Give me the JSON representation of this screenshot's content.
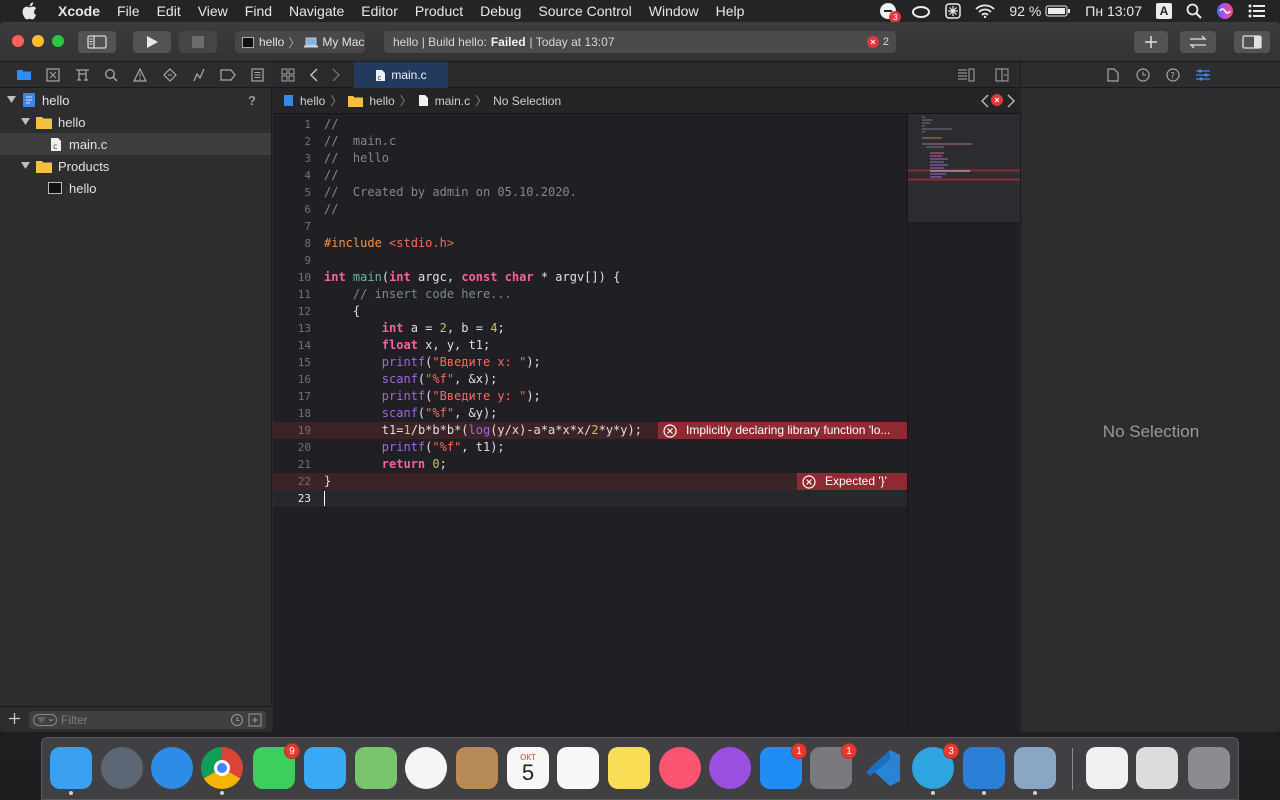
{
  "menubar": {
    "app": "Xcode",
    "items": [
      "File",
      "Edit",
      "View",
      "Find",
      "Navigate",
      "Editor",
      "Product",
      "Debug",
      "Source Control",
      "Window",
      "Help"
    ],
    "battery": "92 %",
    "clock": "Пн 13:07",
    "input": "A",
    "badge_count": "3"
  },
  "toolbar": {
    "scheme": "hello",
    "destination": "My Mac",
    "status_prefix": "hello | Build hello:",
    "status_result": "Failed",
    "status_suffix": "| Today at 13:07",
    "error_count": "2"
  },
  "navigator": {
    "tree": [
      {
        "label": "hello",
        "level": 0,
        "kind": "project",
        "badge": "?"
      },
      {
        "label": "hello",
        "level": 1,
        "kind": "folder"
      },
      {
        "label": "main.c",
        "level": 2,
        "kind": "cfile",
        "selected": true
      },
      {
        "label": "Products",
        "level": 1,
        "kind": "folder"
      },
      {
        "label": "hello",
        "level": 2,
        "kind": "exec"
      }
    ],
    "filter_placeholder": "Filter"
  },
  "editor": {
    "tab": "main.c",
    "jumpbar": [
      "hello",
      "hello",
      "main.c",
      "No Selection"
    ],
    "lines": [
      {
        "n": "1",
        "html": "<span class=\"cmt\">//</span>"
      },
      {
        "n": "2",
        "html": "<span class=\"cmt\">//  main.c</span>"
      },
      {
        "n": "3",
        "html": "<span class=\"cmt\">//  hello</span>"
      },
      {
        "n": "4",
        "html": "<span class=\"cmt\">//</span>"
      },
      {
        "n": "5",
        "html": "<span class=\"cmt\">//  Created by admin on 05.10.2020.</span>"
      },
      {
        "n": "6",
        "html": "<span class=\"cmt\">//</span>"
      },
      {
        "n": "7",
        "html": ""
      },
      {
        "n": "8",
        "html": "<span class=\"pp\">#include</span> <span class=\"inc\">&lt;stdio.h&gt;</span>"
      },
      {
        "n": "9",
        "html": ""
      },
      {
        "n": "10",
        "html": "<span class=\"kw\">int</span> <span class=\"fn2\">main</span>(<span class=\"kw\">int</span> argc, <span class=\"kw\">const</span> <span class=\"kw\">char</span> * argv[]) {"
      },
      {
        "n": "11",
        "html": "    <span class=\"cmt\">// insert code here...</span>"
      },
      {
        "n": "12",
        "html": "    {"
      },
      {
        "n": "13",
        "html": "        <span class=\"kw\">int</span> a = <span class=\"num\">2</span>, b = <span class=\"num\">4</span>;"
      },
      {
        "n": "14",
        "html": "        <span class=\"kw\">float</span> x, y, t1;"
      },
      {
        "n": "15",
        "html": "        <span class=\"fn\">printf</span>(<span class=\"str\">\"Введите x: \"</span>);"
      },
      {
        "n": "16",
        "html": "        <span class=\"fn\">scanf</span>(<span class=\"str\">\"%f\"</span>, &amp;x);"
      },
      {
        "n": "17",
        "html": "        <span class=\"fn\">printf</span>(<span class=\"str\">\"Введите y: \"</span>);"
      },
      {
        "n": "18",
        "html": "        <span class=\"fn\">scanf</span>(<span class=\"str\">\"%f\"</span>, &amp;y);"
      },
      {
        "n": "19",
        "html": "        t1=<span class=\"num\">1</span>/b*b*b*(<span class=\"fn\">log</span>(y/x)-a*a*x*x/<span class=\"num\">2</span>*y*y);",
        "error": "Implicitly declaring library function 'lo..."
      },
      {
        "n": "20",
        "html": "        <span class=\"fn\">printf</span>(<span class=\"str\">\"%f\"</span>, t1);"
      },
      {
        "n": "21",
        "html": "        <span class=\"kw\">return</span> <span class=\"num\">0</span>;"
      },
      {
        "n": "22",
        "html": "}",
        "error": "Expected '}'"
      },
      {
        "n": "23",
        "html": "",
        "current": true
      }
    ]
  },
  "inspector": {
    "empty_label": "No Selection"
  },
  "dock": {
    "apps": [
      {
        "name": "finder",
        "color": "#3aa0f2"
      },
      {
        "name": "launchpad",
        "color": "#5c6675"
      },
      {
        "name": "safari",
        "color": "#2d8de6"
      },
      {
        "name": "chrome",
        "color": "#e8e8e8"
      },
      {
        "name": "facetime",
        "color": "#3ccf5c",
        "badge": "9"
      },
      {
        "name": "messages",
        "color": "#3aa9f5"
      },
      {
        "name": "maps",
        "color": "#7ac46e"
      },
      {
        "name": "photos",
        "color": "#f5f5f5"
      },
      {
        "name": "contacts",
        "color": "#b88a55"
      },
      {
        "name": "calendar",
        "color": "#f7f7f7",
        "day": "5",
        "month": "ОКТ"
      },
      {
        "name": "reminders",
        "color": "#f7f7f7"
      },
      {
        "name": "notes",
        "color": "#f8dd55"
      },
      {
        "name": "music",
        "color": "#fa5470"
      },
      {
        "name": "podcasts",
        "color": "#9b4fe0"
      },
      {
        "name": "app-store",
        "color": "#1f8df3",
        "badge": "1"
      },
      {
        "name": "system-preferences",
        "color": "#7a7a7e",
        "badge": "1"
      },
      {
        "name": "vscode",
        "color": "#2a84d6"
      },
      {
        "name": "telegram",
        "color": "#2ea5e0",
        "badge": "3"
      },
      {
        "name": "xcode",
        "color": "#2b7fd8"
      },
      {
        "name": "preview",
        "color": "#8aa6c4"
      },
      {
        "name": "document",
        "color": "#f0f0f0"
      },
      {
        "name": "chrome-window",
        "color": "#dcdcdc"
      },
      {
        "name": "trash",
        "color": "#8c8c90"
      }
    ]
  }
}
